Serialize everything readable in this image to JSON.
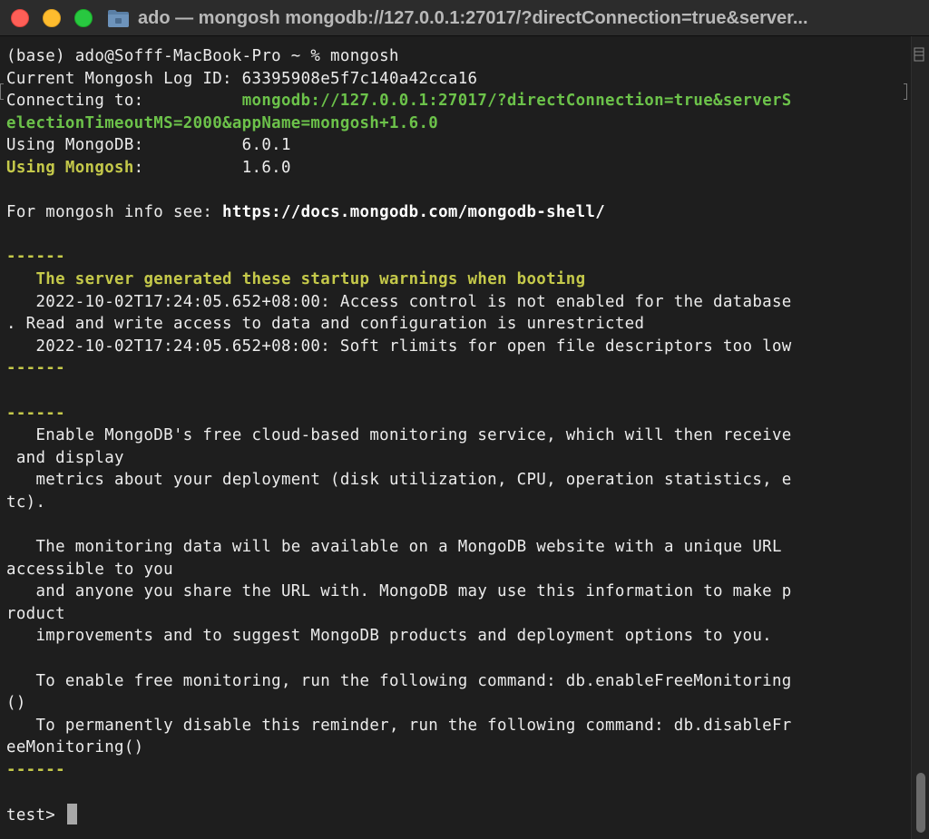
{
  "window": {
    "title": "ado — mongosh mongodb://127.0.0.1:27017/?directConnection=true&server..."
  },
  "icons": {
    "folder": "folder-icon",
    "close": "close-button",
    "minimize": "minimize-button",
    "zoom": "zoom-button",
    "menu": "menu-icon"
  },
  "colors": {
    "green": "#6cc24a",
    "yellow": "#c5c94a",
    "text": "#ececec",
    "background": "#1e1e1e"
  },
  "terminal": {
    "lines": [
      [
        {
          "t": "(base) ado@Sofff-MacBook-Pro ~ % mongosh"
        }
      ],
      [
        {
          "t": "Current Mongosh Log ID: 63395908e5f7c140a42cca16"
        }
      ],
      [
        {
          "t": "Connecting to:          "
        },
        {
          "t": "mongodb://127.0.0.1:27017/?directConnection=true&serverS",
          "c": "green"
        }
      ],
      [
        {
          "t": "electionTimeoutMS=2000&appName=mongosh+1.6.0",
          "c": "green"
        }
      ],
      [
        {
          "t": "Using MongoDB:          6.0.1"
        }
      ],
      [
        {
          "t": "Using Mongosh",
          "c": "yellow"
        },
        {
          "t": ":          1.6.0"
        }
      ],
      [
        {
          "t": ""
        }
      ],
      [
        {
          "t": "For mongosh info see: "
        },
        {
          "t": "https://docs.mongodb.com/mongodb-shell/",
          "c": "bold"
        }
      ],
      [
        {
          "t": ""
        }
      ],
      [
        {
          "t": "------",
          "c": "yellow"
        }
      ],
      [
        {
          "t": "   "
        },
        {
          "t": "The server generated these startup warnings when booting",
          "c": "yellow"
        }
      ],
      [
        {
          "t": "   2022-10-02T17:24:05.652+08:00: Access control is not enabled for the database"
        }
      ],
      [
        {
          "t": ". Read and write access to data and configuration is unrestricted"
        }
      ],
      [
        {
          "t": "   2022-10-02T17:24:05.652+08:00: Soft rlimits for open file descriptors too low"
        }
      ],
      [
        {
          "t": "------",
          "c": "yellow"
        }
      ],
      [
        {
          "t": ""
        }
      ],
      [
        {
          "t": "------",
          "c": "yellow"
        }
      ],
      [
        {
          "t": "   Enable MongoDB's free cloud-based monitoring service, which will then receive"
        }
      ],
      [
        {
          "t": " and display"
        }
      ],
      [
        {
          "t": "   metrics about your deployment (disk utilization, CPU, operation statistics, e"
        }
      ],
      [
        {
          "t": "tc)."
        }
      ],
      [
        {
          "t": ""
        }
      ],
      [
        {
          "t": "   The monitoring data will be available on a MongoDB website with a unique URL"
        }
      ],
      [
        {
          "t": "accessible to you"
        }
      ],
      [
        {
          "t": "   and anyone you share the URL with. MongoDB may use this information to make p"
        }
      ],
      [
        {
          "t": "roduct"
        }
      ],
      [
        {
          "t": "   improvements and to suggest MongoDB products and deployment options to you."
        }
      ],
      [
        {
          "t": ""
        }
      ],
      [
        {
          "t": "   To enable free monitoring, run the following command: db.enableFreeMonitoring"
        }
      ],
      [
        {
          "t": "()"
        }
      ],
      [
        {
          "t": "   To permanently disable this reminder, run the following command: db.disableFr"
        }
      ],
      [
        {
          "t": "eeMonitoring()"
        }
      ],
      [
        {
          "t": "------",
          "c": "yellow"
        }
      ],
      [
        {
          "t": ""
        }
      ],
      [
        {
          "t": "test> "
        }
      ]
    ],
    "prompt_line_index": 34
  }
}
